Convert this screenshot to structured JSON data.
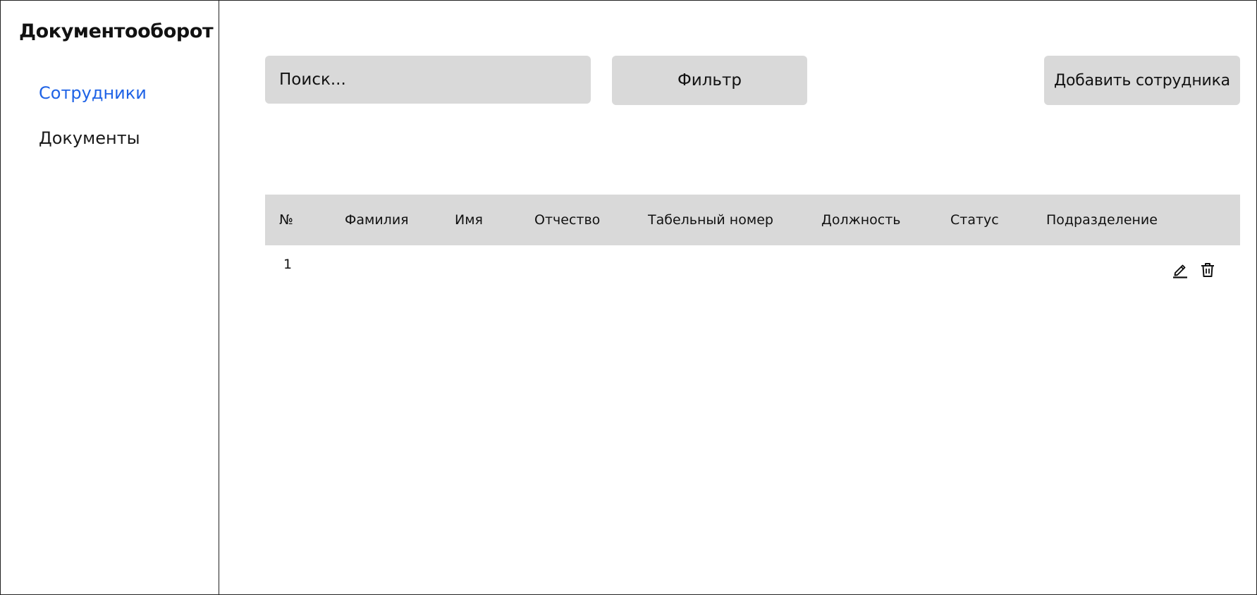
{
  "app": {
    "title": "Документооборот"
  },
  "sidebar": {
    "items": [
      {
        "label": "Сотрудники",
        "active": true
      },
      {
        "label": "Документы",
        "active": false
      }
    ]
  },
  "toolbar": {
    "search_placeholder": "Поиск...",
    "search_value": "",
    "filter_label": "Фильтр",
    "add_label": "Добавить сотрудника"
  },
  "table": {
    "columns": [
      "№",
      "Фамилия",
      "Имя",
      "Отчество",
      "Табельный номер",
      "Должность",
      "Статус",
      "Подразделение"
    ],
    "rows": [
      {
        "num": "1",
        "last_name": "",
        "first_name": "",
        "patronymic": "",
        "personnel_number": "",
        "position": "",
        "status": "",
        "department": "",
        "actions": [
          "edit-icon",
          "trash-icon"
        ]
      }
    ]
  },
  "colors": {
    "accent": "#1f63e6",
    "control_bg": "#d9d9d9",
    "border": "#222222"
  }
}
